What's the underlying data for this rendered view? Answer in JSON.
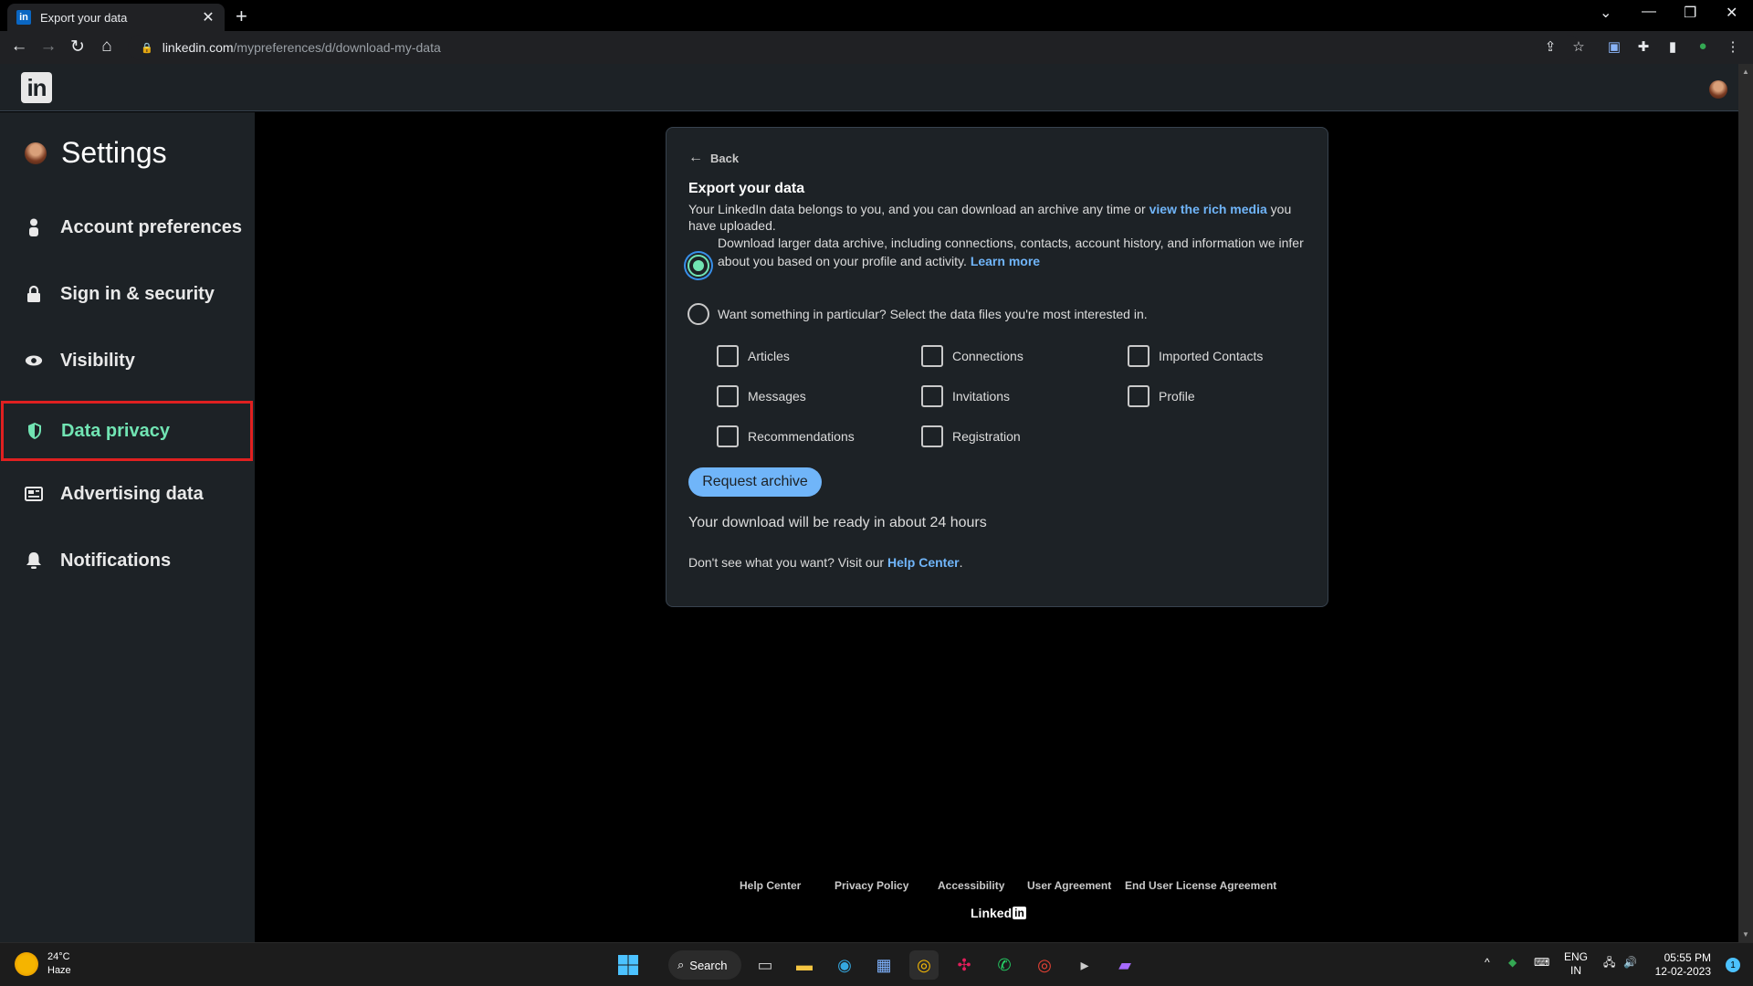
{
  "browser": {
    "tab_title": "Export your data",
    "tab_favicon": "in",
    "new_tab": "+",
    "url_host": "linkedin.com",
    "url_path": "/mypreferences/d/download-my-data"
  },
  "sidebar": {
    "title": "Settings",
    "items": [
      {
        "label": "Account preferences",
        "icon": "person-icon"
      },
      {
        "label": "Sign in & security",
        "icon": "lock-icon"
      },
      {
        "label": "Visibility",
        "icon": "eye-icon"
      },
      {
        "label": "Data privacy",
        "icon": "shield-icon",
        "active": true
      },
      {
        "label": "Advertising data",
        "icon": "ad-icon"
      },
      {
        "label": "Notifications",
        "icon": "bell-icon"
      }
    ]
  },
  "card": {
    "back_label": "Back",
    "title": "Export your data",
    "intro_before": "Your LinkedIn data belongs to you, and you can download an archive any time or ",
    "intro_link": "view the rich media",
    "intro_after": " you have uploaded.",
    "option1_text": "Download larger data archive, including connections, contacts, account history, and information we infer about you based on your profile and activity. ",
    "option1_link": "Learn more",
    "option2_text": "Want something in particular? Select the data files you're most interested in.",
    "checkboxes": [
      "Articles",
      "Connections",
      "Imported Contacts",
      "Messages",
      "Invitations",
      "Profile",
      "Recommendations",
      "Registration"
    ],
    "request_button": "Request archive",
    "ready_text": "Your download will be ready in about 24 hours",
    "help_before": "Don't see what you want? Visit our ",
    "help_link": "Help Center",
    "help_after": "."
  },
  "footer": {
    "links": [
      "Help Center",
      "Privacy Policy",
      "Accessibility",
      "User Agreement",
      "End User License Agreement"
    ],
    "brand": "Linked",
    "brand_in": "in"
  },
  "taskbar": {
    "temp": "24°C",
    "weather": "Haze",
    "search": "Search",
    "lang1": "ENG",
    "lang2": "IN",
    "time": "05:55 PM",
    "date": "12-02-2023",
    "notif_count": "1"
  },
  "colors": {
    "accent_green": "#71e4b3",
    "link_blue": "#70b5f9",
    "highlight_red": "#e02020",
    "card_bg": "#1d2226"
  }
}
